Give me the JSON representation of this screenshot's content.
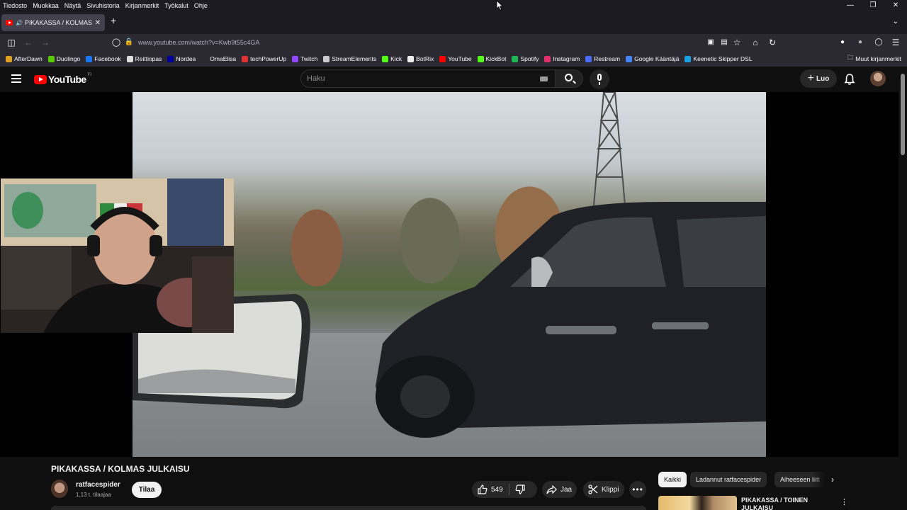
{
  "browser": {
    "menu": [
      "Tiedosto",
      "Muokkaa",
      "Näytä",
      "Sivuhistoria",
      "Kirjanmerkit",
      "Työkalut",
      "Ohje"
    ],
    "tab_title": "PIKAKASSA / KOLMAS JULKAISU",
    "url": "www.youtube.com/watch?v=Kwb9t55c4GA",
    "bookmarks": [
      {
        "label": "AfterDawn",
        "color": "#e0a020"
      },
      {
        "label": "Duolingo",
        "color": "#58cc02"
      },
      {
        "label": "Facebook",
        "color": "#1877f2"
      },
      {
        "label": "Reittiopas",
        "color": "#dddddd"
      },
      {
        "label": "Nordea",
        "color": "#0000a0"
      },
      {
        "label": "OmaElisa",
        "color": "#2b2a33"
      },
      {
        "label": "techPowerUp",
        "color": "#e03030"
      },
      {
        "label": "Twitch",
        "color": "#9146ff"
      },
      {
        "label": "StreamElements",
        "color": "#cccccc"
      },
      {
        "label": "Kick",
        "color": "#53fc18"
      },
      {
        "label": "BotRix",
        "color": "#eeeeee"
      },
      {
        "label": "YouTube",
        "color": "#ff0000"
      },
      {
        "label": "KickBot",
        "color": "#53fc18"
      },
      {
        "label": "Spotify",
        "color": "#1db954"
      },
      {
        "label": "Instagram",
        "color": "#e1306c"
      },
      {
        "label": "Restream",
        "color": "#4a6cf7"
      },
      {
        "label": "Google Kääntäjä",
        "color": "#4285f4"
      },
      {
        "label": "Keenetic Skipper DSL",
        "color": "#1ba0e2"
      }
    ],
    "other_bookmarks": "Muut kirjanmerkit"
  },
  "youtube": {
    "logo_text": "YouTube",
    "country_code": "FI",
    "search_placeholder": "Haku",
    "create_label": "Luo",
    "video_title": "PIKAKASSA / KOLMAS JULKAISU",
    "channel_name": "ratfacespider",
    "subscribers": "1,13 t. tilaajaa",
    "subscribe_label": "Tilaa",
    "like_count": "549",
    "share_label": "Jaa",
    "clip_label": "Klippi",
    "chips": [
      "Kaikki",
      "Ladannut ratfacespider",
      "Aiheeseen liitt"
    ],
    "recommended": {
      "title": "PIKAKASSA / TOINEN JULKAISU"
    }
  },
  "colors": {
    "youtube_red": "#ff0000",
    "background": "#0f0f0f",
    "chip_bg": "#272727"
  }
}
